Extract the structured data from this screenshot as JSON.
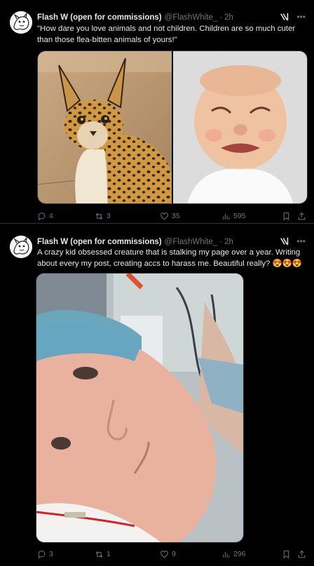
{
  "tweets": [
    {
      "author_name": "Flash W (open for commissions)",
      "handle": "@FlashWhite_",
      "separator": "·",
      "time": "2h",
      "text": "\"How dare you love animals and not children. Children are so much cuter than those flea-bitten animals of yours!\"",
      "media": [
        "serval-cat-photo",
        "crying-baby-photo"
      ],
      "actions": {
        "replies": "4",
        "reposts": "3",
        "likes": "35",
        "views": "595"
      }
    },
    {
      "author_name": "Flash W (open for commissions)",
      "handle": "@FlashWhite_",
      "separator": "·",
      "time": "2h",
      "text": "A crazy kid obsessed creature that is stalking my page over a year. Writing about every my post, creating accs to harass me. Beautiful really? 😍😍😍",
      "media": [
        "hospital-selfie-photo"
      ],
      "actions": {
        "replies": "3",
        "reposts": "1",
        "likes": "9",
        "views": "296"
      }
    }
  ],
  "icons": {
    "reply": "reply-icon",
    "repost": "repost-icon",
    "like": "heart-icon",
    "views": "views-icon",
    "bookmark": "bookmark-icon",
    "share": "share-icon",
    "grok": "grok-icon",
    "more": "more-icon"
  },
  "colors": {
    "background": "#000000",
    "text": "#e7e9ea",
    "secondary": "#71767b",
    "border": "#2f3336"
  }
}
